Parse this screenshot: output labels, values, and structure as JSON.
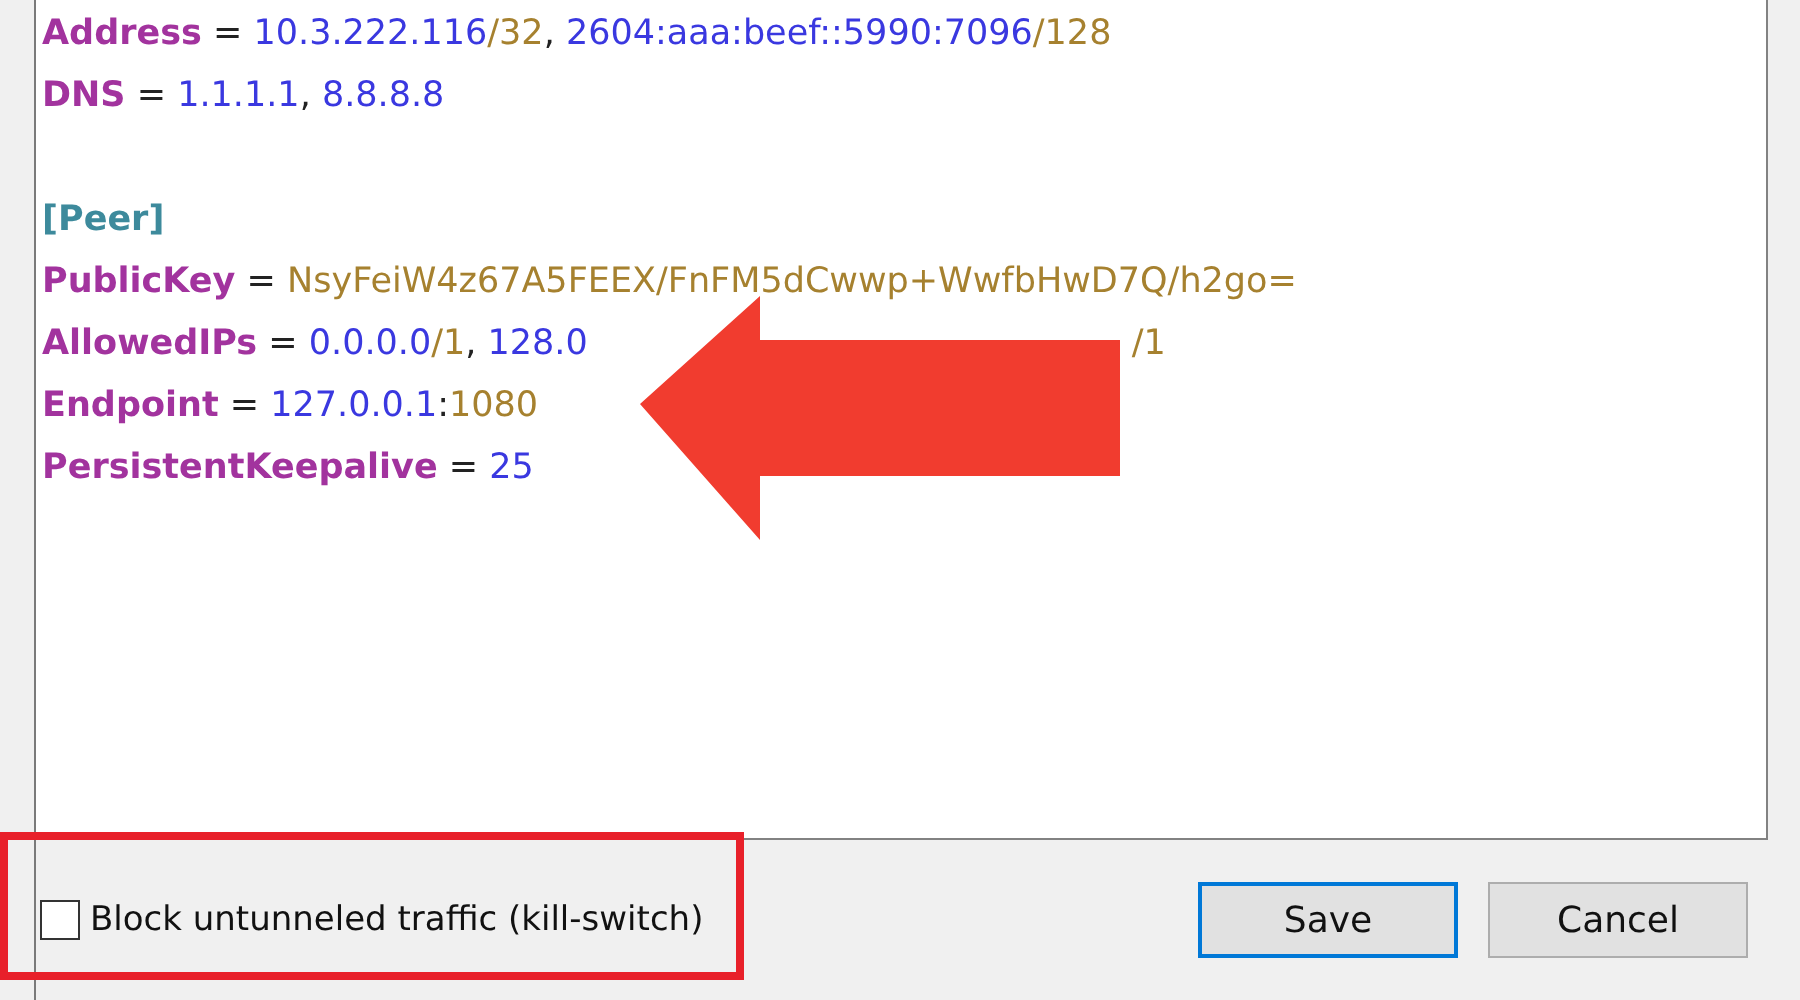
{
  "editor": {
    "lines": [
      {
        "kind": "pair",
        "key": "Address",
        "sep": " = ",
        "tokens": [
          {
            "text": "10.3.222.116",
            "kind": "value"
          },
          {
            "text": "/32",
            "kind": "suffix"
          },
          {
            "text": ", ",
            "kind": "punct"
          },
          {
            "text": "2604:aaa:beef::5990:7096",
            "kind": "value"
          },
          {
            "text": "/128",
            "kind": "suffix"
          }
        ]
      },
      {
        "kind": "pair",
        "key": "DNS",
        "sep": " = ",
        "tokens": [
          {
            "text": "1.1.1.1",
            "kind": "value"
          },
          {
            "text": ", ",
            "kind": "punct"
          },
          {
            "text": "8.8.8.8",
            "kind": "value"
          }
        ]
      },
      {
        "kind": "blank"
      },
      {
        "kind": "section",
        "text": "[Peer]"
      },
      {
        "kind": "pair",
        "key": "PublicKey",
        "sep": " = ",
        "tokens": [
          {
            "text": "NsyFeiW4z67A5FEEX/FnFM5dCwwp+WwfbHwD7Q/h2go=",
            "kind": "suffix"
          }
        ]
      },
      {
        "kind": "pair",
        "key": "AllowedIPs",
        "sep": " = ",
        "tokens": [
          {
            "text": "0.0.0.0",
            "kind": "value"
          },
          {
            "text": "/1",
            "kind": "suffix"
          },
          {
            "text": ", ",
            "kind": "punct"
          },
          {
            "text": "128.0",
            "kind": "value"
          },
          {
            "text": "/1",
            "kind": "tail"
          }
        ]
      },
      {
        "kind": "pair",
        "key": "Endpoint",
        "sep": " = ",
        "tokens": [
          {
            "text": "127.0.0.1",
            "kind": "value"
          },
          {
            "text": ":",
            "kind": "punct"
          },
          {
            "text": "1080",
            "kind": "suffix"
          }
        ]
      },
      {
        "kind": "pair",
        "key": "PersistentKeepalive",
        "sep": " = ",
        "tokens": [
          {
            "text": "25",
            "kind": "value"
          }
        ]
      }
    ]
  },
  "kill_switch": {
    "label": "Block untunneled traffic (kill-switch)",
    "checked": false
  },
  "buttons": [
    {
      "label": "Save",
      "default": true
    },
    {
      "label": "Cancel",
      "default": false
    }
  ]
}
